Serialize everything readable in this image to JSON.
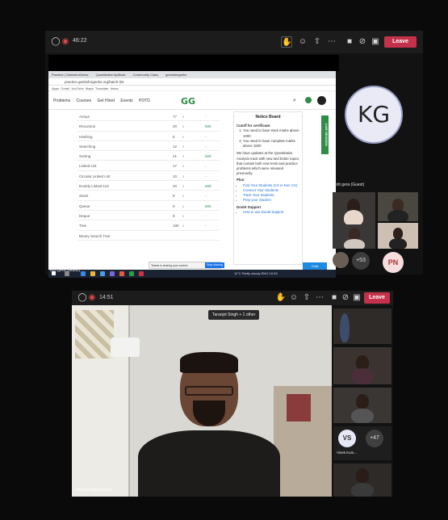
{
  "top_meeting": {
    "timer": "46:22",
    "leave_label": "Leave",
    "browser": {
      "tabs": [
        "Practice | GeeksforGeeks",
        "Quantitative Aptitude",
        "Community Class",
        "geeksforgeeks"
      ],
      "url": "practice.geeksforgeeks.org/batch-list",
      "bookmarks": [
        "Apps",
        "Gmail",
        "YouTube",
        "Maps",
        "Translate",
        "News"
      ]
    },
    "site": {
      "nav": [
        "Problems",
        "Courses",
        "Get Hired",
        "Events",
        "POTD"
      ],
      "logo": "GG",
      "search_icon": "search-icon"
    },
    "topics": [
      {
        "name": "Arrays",
        "count": "77",
        "mark": "x",
        "score": "-"
      },
      {
        "name": "Recursion",
        "count": "20",
        "mark": "x",
        "score": "500"
      },
      {
        "name": "Hashing",
        "count": "8",
        "mark": "x",
        "score": "-"
      },
      {
        "name": "Searching",
        "count": "12",
        "mark": "x",
        "score": "-"
      },
      {
        "name": "Sorting",
        "count": "21",
        "mark": "x",
        "score": "500"
      },
      {
        "name": "Linked List",
        "count": "17",
        "mark": "x",
        "score": "-"
      },
      {
        "name": "Circular Linked List",
        "count": "10",
        "mark": "x",
        "score": "-"
      },
      {
        "name": "Doubly Linked List",
        "count": "20",
        "mark": "x",
        "score": "500"
      },
      {
        "name": "Stack",
        "count": "9",
        "mark": "x",
        "score": "-"
      },
      {
        "name": "Queue",
        "count": "8",
        "mark": "x",
        "score": "500"
      },
      {
        "name": "Deque",
        "count": "8",
        "mark": "x",
        "score": "-"
      },
      {
        "name": "Tree",
        "count": "180",
        "mark": "x",
        "score": "-"
      },
      {
        "name": "Binary Search Tree",
        "count": "",
        "mark": "",
        "score": ""
      }
    ],
    "notice": {
      "title": "Notice Board",
      "cutoff_title": "Cutoff for certificate:",
      "cutoff_items": [
        "You need to have track marks above 1000",
        "You need to have complete marks above 1500"
      ],
      "update_text": "We have updates at the Quantitative Analysis track with new and better topics that contain both new tests and practice problems which were released previously.",
      "plus_title": "Plus:",
      "plus_items": [
        "Find Your Students (CS in Non CS)",
        "Connect Your Students",
        "Track Your Students",
        "Prep your Student"
      ],
      "doubt_title": "Doubt Support",
      "doubt_items": [
        "How to use Doubt Support"
      ]
    },
    "live_tab": "LIVE SESSION",
    "share_banner": "Teams is sharing your screen",
    "stop_share": "Stop sharing",
    "chat_button": "Chat",
    "taskbar_tray": "11°C  Partly cloudy   ENG   10:33",
    "presenter_name": "kirti gera (Guest)",
    "kg_avatar": "KG",
    "kg_name": "kirti gera (Guest)",
    "extra_count": "+53",
    "pn_avatar": "PN"
  },
  "bottom_meeting": {
    "timer": "14:51",
    "leave_label": "Leave",
    "speaker_badge": "Taranjot Singh + 1 other",
    "main_name": "Ankit Kalap (Guest)",
    "vs_avatar": "VS",
    "vs_name": "Vivek Kum...",
    "extra_count": "+47"
  },
  "colors": {
    "leave_red": "#c4314b",
    "gfg_green": "#2f8d46",
    "link_blue": "#1e6fd9"
  }
}
